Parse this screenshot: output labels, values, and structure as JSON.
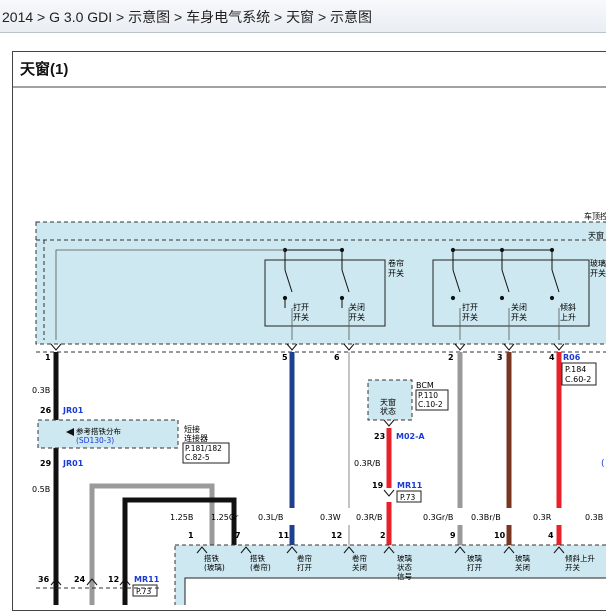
{
  "breadcrumb": {
    "items": [
      "2014",
      "G 3.0 GDI",
      "示意图",
      "车身电气系统",
      "天窗",
      "示意图"
    ],
    "separator": ">"
  },
  "diagram": {
    "title": "天窗(1)",
    "top_box": {
      "label_right_1": "车顶控",
      "label_right_2": "天窗",
      "group_left_label": "卷帘\n开关",
      "group_right_label": "玻璃\n开关",
      "switch_labels": [
        "打开\n开关",
        "关闭\n开关",
        "打开\n开关",
        "关闭\n开关",
        "倾斜\n上升"
      ]
    },
    "pins_top": [
      "1",
      "5",
      "6",
      "2",
      "3",
      "4"
    ],
    "connector_R06": {
      "id": "R06",
      "refs": [
        "P.184",
        "C.60-2"
      ]
    },
    "left_branch": {
      "wire_top": "0.3B",
      "pin_26": "26",
      "jr01_top": "JR01",
      "splice_label": "参考搭铁分布",
      "splice_ref": "(SD130-3)",
      "joint_label": "短接\n连接器",
      "joint_refs": [
        "P.181/182",
        "C.82-5"
      ],
      "pin_29": "29",
      "jr01_bottom": "JR01",
      "wire_bottom": "0.5B"
    },
    "bcm": {
      "label": "BCM",
      "refs": [
        "P.110",
        "C.10-2"
      ],
      "state_label": "天窗\n状态",
      "pin": "23",
      "connector": "M02-A",
      "wire": "0.3R/B",
      "pin_19": "19",
      "mr11": "MR11",
      "mr11_ref": "P.73"
    },
    "wire_labels": [
      "1.25B",
      "1.25Gr",
      "0.3L/B",
      "0.3W",
      "0.3R/B",
      "0.3Gr/B",
      "0.3Br/B",
      "0.3R",
      "0.3B"
    ],
    "pins_bottom": [
      "1",
      "7",
      "11",
      "12",
      "2",
      "9",
      "10",
      "4"
    ],
    "bottom_labels": [
      "搭铁\n(玻璃)",
      "搭铁\n(卷帘)",
      "卷帘\n打开",
      "卷帘\n关闭",
      "玻璃\n状态\n信号",
      "玻璃\n打开",
      "玻璃\n关闭",
      "倾斜上升\n开关"
    ],
    "bottom_left": {
      "pin_36": "36",
      "pin_24": "24",
      "pin_12": "12",
      "mr11": "MR11",
      "mr11_ref": "P.73"
    },
    "stray_mark": "("
  },
  "colors": {
    "box_fill": "#cde8f0",
    "wire_blue": "#1f3f8f",
    "wire_red": "#e8202a",
    "wire_brown": "#7a3520",
    "wire_gray": "#9a9a9a",
    "link_blue": "#1a3bd6"
  }
}
